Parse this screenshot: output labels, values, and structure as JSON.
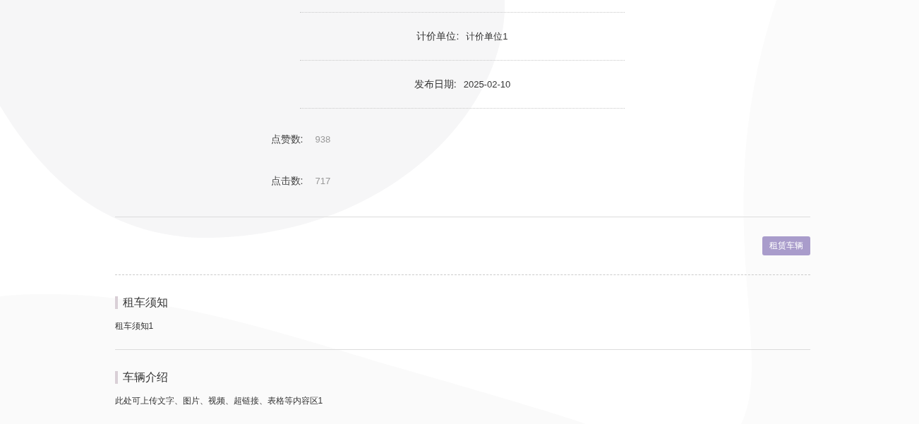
{
  "detail_rows": [
    {
      "label": "计价单位:",
      "value": "计价单位1"
    },
    {
      "label": "发布日期:",
      "value": "2025-02-10"
    }
  ],
  "stats": [
    {
      "label": "点赞数:",
      "value": "938"
    },
    {
      "label": "点击数:",
      "value": "717"
    }
  ],
  "action_button": {
    "label": "租赁车辆"
  },
  "sections": [
    {
      "title": "租车须知",
      "body": "租车须知1"
    },
    {
      "title": "车辆介绍",
      "body": "此处可上传文字、图片、视频、超链接、表格等内容区1"
    }
  ]
}
